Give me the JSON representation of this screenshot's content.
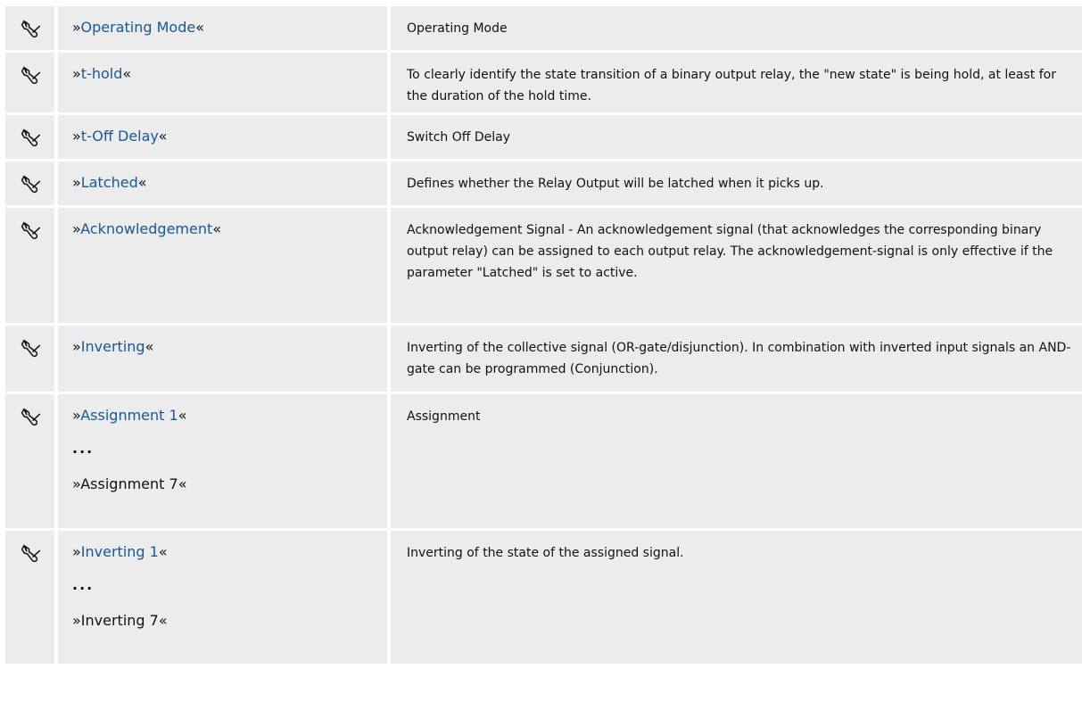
{
  "quote_open": "»",
  "quote_close": "«",
  "ellipsis": "...",
  "rows": [
    {
      "name": "Operating Mode",
      "desc": "Operating Mode"
    },
    {
      "name": "t-hold",
      "desc": "To clearly identify the state transition of a binary output relay, the \"new state\" is being hold, at least for the duration of the hold time."
    },
    {
      "name": "t-Off Delay",
      "desc": "Switch Off Delay"
    },
    {
      "name": "Latched",
      "desc": "Defines whether the Relay Output will be latched when it picks up."
    },
    {
      "name": "Acknowledgement",
      "desc": "Acknowledgement Signal - An acknowledgement signal (that acknowledges the corresponding binary output relay) can be assigned to each output relay. The acknowledgement-signal is only effective if the parameter \"Latched\" is set to active."
    },
    {
      "name": "Inverting",
      "desc": "Inverting of the collective signal (OR-gate/disjunction). In combination with inverted input signals an AND-gate can be programmed (Conjunction)."
    },
    {
      "name": "Assignment 1",
      "name_end": "Assignment 7",
      "desc": "Assignment"
    },
    {
      "name": "Inverting 1",
      "name_end": "Inverting 7",
      "desc": "Inverting of the state of the assigned signal."
    }
  ],
  "colors": {
    "link": "#15589c",
    "row_background": "#ececec"
  },
  "icon": "wrench-icon"
}
